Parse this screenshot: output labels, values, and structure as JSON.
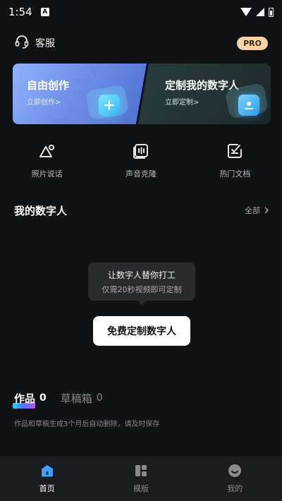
{
  "status": {
    "time": "1:54",
    "notif_letter": "A"
  },
  "header": {
    "support_label": "客服",
    "pro_badge": "PRO"
  },
  "cards": [
    {
      "title": "自由创作",
      "subtitle": "立即创作>"
    },
    {
      "title": "定制我的数字人",
      "subtitle": "立即定制>"
    }
  ],
  "features": [
    {
      "label": "照片说话",
      "icon": "photo-talk-icon"
    },
    {
      "label": "声音克隆",
      "icon": "voice-clone-icon"
    },
    {
      "label": "热门文档",
      "icon": "hot-docs-icon"
    }
  ],
  "digital_humans": {
    "title": "我的数字人",
    "more_label": "全部",
    "tooltip_line1": "让数字人替你打工",
    "tooltip_line2": "仅需20秒视频即可定制",
    "cta_label": "免费定制数字人"
  },
  "works": {
    "tab_works": "作品",
    "works_count": "0",
    "tab_drafts": "草稿箱",
    "drafts_count": "0",
    "note": "作品和草稿生成3个月后自动删除，请及时保存"
  },
  "nav": [
    {
      "label": "首页",
      "icon": "home-icon",
      "active": true
    },
    {
      "label": "模版",
      "icon": "templates-icon",
      "active": false
    },
    {
      "label": "我的",
      "icon": "profile-icon",
      "active": false
    }
  ]
}
